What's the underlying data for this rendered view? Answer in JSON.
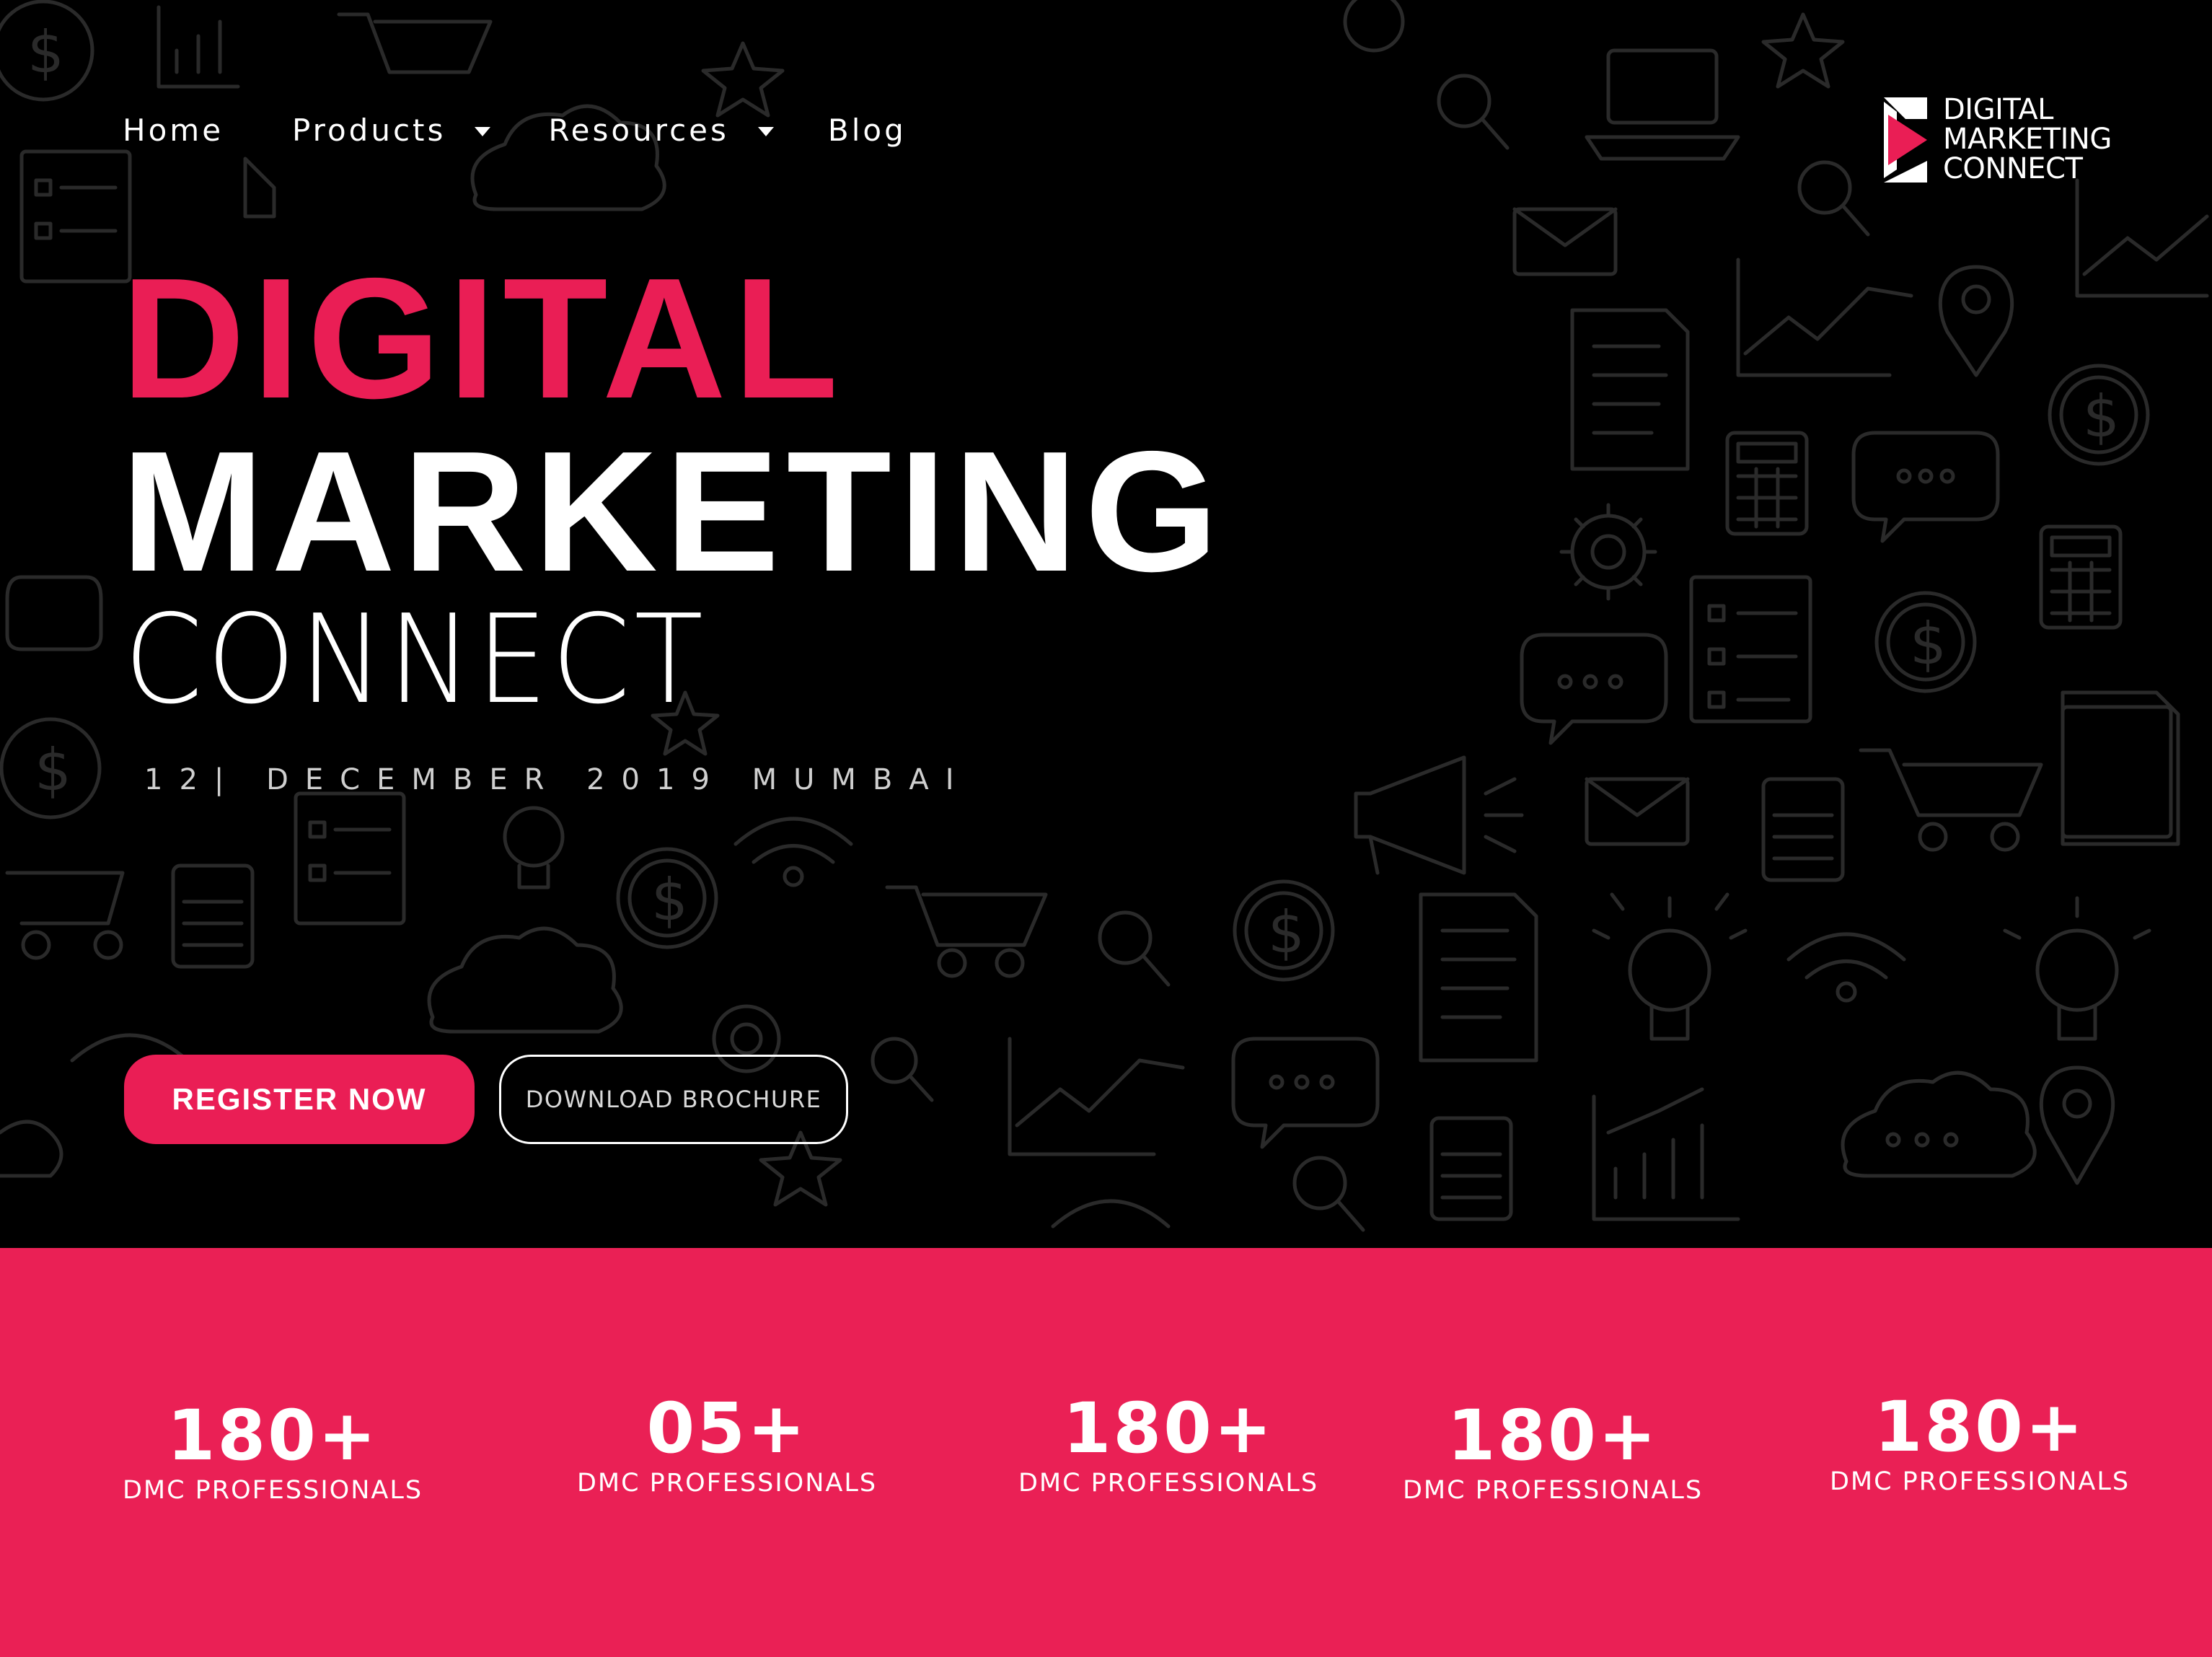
{
  "colors": {
    "accent": "#ea1e55",
    "background": "#000000",
    "stats_band": "#ea2055",
    "text": "#ffffff"
  },
  "nav": {
    "items": [
      {
        "label": "Home",
        "dropdown": false
      },
      {
        "label": "Products",
        "dropdown": true
      },
      {
        "label": "Resources",
        "dropdown": true
      },
      {
        "label": "Blog",
        "dropdown": false
      }
    ]
  },
  "logo": {
    "lines": [
      "DIGITAL",
      "MARKETING",
      "CONNECT"
    ],
    "icon": "play-triangle-logo-icon"
  },
  "hero": {
    "title_line1": "DIGITAL",
    "title_line2": "MARKETING",
    "title_line3": "CONNECT",
    "date": "12| DECEMBER 2019 MUMBAI"
  },
  "buttons": {
    "register": "REGISTER NOW",
    "brochure": "DOWNLOAD BROCHURE"
  },
  "stats": [
    {
      "value": "180+",
      "label": "DMC PROFESSIONALS"
    },
    {
      "value": "05+",
      "label": "DMC PROFESSIONALS"
    },
    {
      "value": "180+",
      "label": "DMC PROFESSIONALS"
    },
    {
      "value": "180+",
      "label": "DMC PROFESSIONALS"
    },
    {
      "value": "180+",
      "label": "DMC PROFESSIONALS"
    }
  ]
}
